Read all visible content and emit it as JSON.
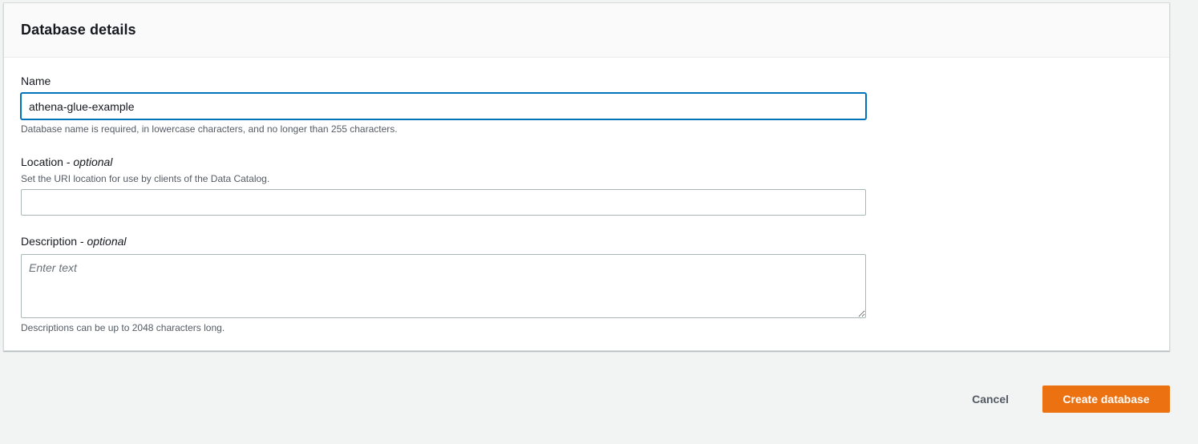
{
  "panel": {
    "title": "Database details"
  },
  "fields": {
    "name": {
      "label": "Name",
      "value": "athena-glue-example",
      "hint": "Database name is required, in lowercase characters, and no longer than 255 characters."
    },
    "location": {
      "label": "Location - ",
      "optional": "optional",
      "hint": "Set the URI location for use by clients of the Data Catalog.",
      "value": ""
    },
    "description": {
      "label": "Description - ",
      "optional": "optional",
      "placeholder": "Enter text",
      "hint": "Descriptions can be up to 2048 characters long."
    }
  },
  "actions": {
    "cancel_label": "Cancel",
    "create_label": "Create database"
  },
  "colors": {
    "primary": "#ec7211",
    "focus": "#0073bb"
  }
}
